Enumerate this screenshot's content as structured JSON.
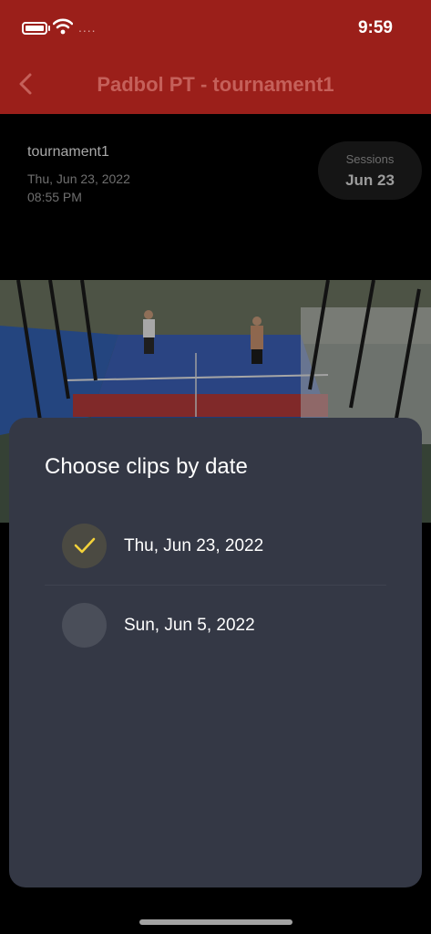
{
  "status_bar": {
    "time": "9:59",
    "carrier_dots": "...."
  },
  "header": {
    "title": "Padbol PT - tournament1"
  },
  "session": {
    "name": "tournament1",
    "date": "Thu, Jun 23, 2022",
    "time": "08:55 PM",
    "sessions_label": "Sessions",
    "sessions_value": "Jun 23"
  },
  "sheet": {
    "title": "Choose clips by date",
    "options": [
      {
        "label": "Thu, Jun 23, 2022",
        "selected": true
      },
      {
        "label": "Sun, Jun 5, 2022",
        "selected": false
      }
    ]
  },
  "colors": {
    "header": "#9b1f1a",
    "sheet": "#343845",
    "check": "#f3d23a"
  }
}
